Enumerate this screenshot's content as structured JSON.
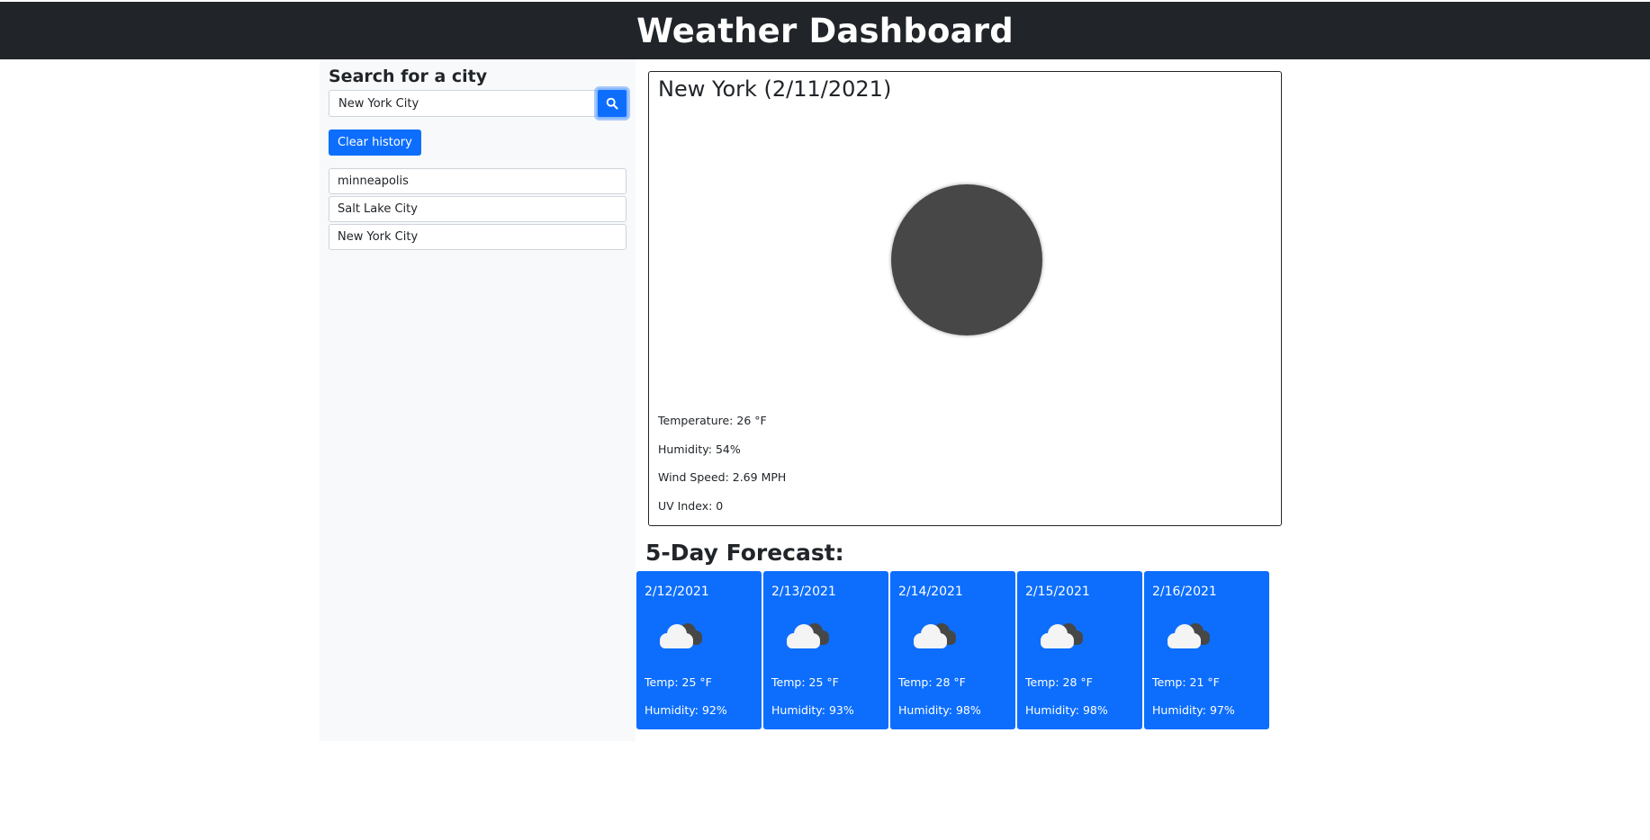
{
  "header": {
    "title": "Weather Dashboard"
  },
  "sidebar": {
    "heading": "Search for a city",
    "search": {
      "value": "New York City",
      "icon": "search-icon"
    },
    "clear_label": "Clear history",
    "history": [
      "minneapolis",
      "Salt Lake City",
      "New York City"
    ]
  },
  "current": {
    "title": "New York (2/11/2021)",
    "icon": "moon-icon",
    "temperature": "Temperature: 26 °F",
    "humidity": "Humidity: 54%",
    "wind": "Wind Speed: 2.69 MPH",
    "uv": "UV Index: 0"
  },
  "forecast": {
    "heading": "5-Day Forecast:",
    "days": [
      {
        "date": "2/12/2021",
        "icon": "cloud-icon",
        "temp": "Temp: 25 °F",
        "humidity": "Humidity: 92%"
      },
      {
        "date": "2/13/2021",
        "icon": "cloud-icon",
        "temp": "Temp: 25 °F",
        "humidity": "Humidity: 93%"
      },
      {
        "date": "2/14/2021",
        "icon": "cloud-icon",
        "temp": "Temp: 28 °F",
        "humidity": "Humidity: 98%"
      },
      {
        "date": "2/15/2021",
        "icon": "cloud-icon",
        "temp": "Temp: 28 °F",
        "humidity": "Humidity: 98%"
      },
      {
        "date": "2/16/2021",
        "icon": "cloud-icon",
        "temp": "Temp: 21 °F",
        "humidity": "Humidity: 97%"
      }
    ]
  },
  "colors": {
    "header_bg": "#212529",
    "primary": "#0d6efd",
    "sidebar_bg": "#f8f9fa",
    "icon_dark": "#474747"
  }
}
